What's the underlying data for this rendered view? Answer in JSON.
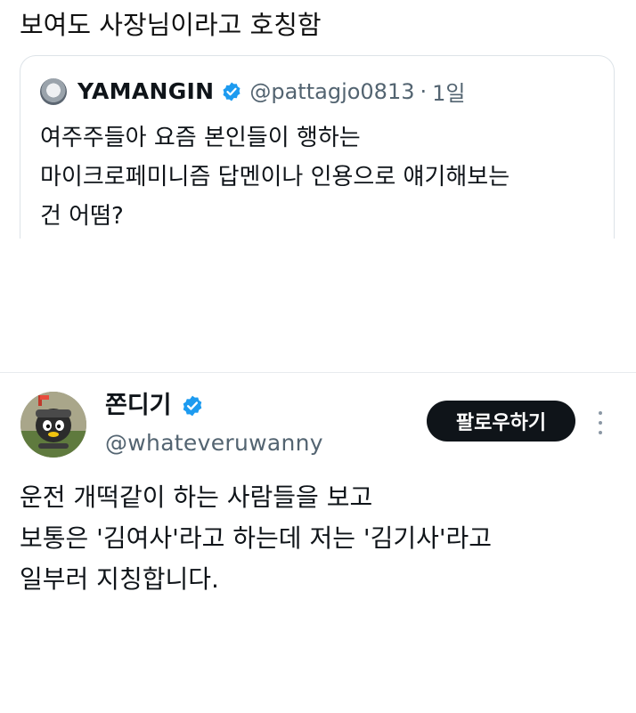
{
  "caption": "보여도 사장님이라고 호칭함",
  "quoted_tweet": {
    "display_name": "YAMANGIN",
    "handle": "@pattagjo0813",
    "separator": "·",
    "time": "1일",
    "text_lines": [
      "여주주들아 요즘 본인들이 행하는",
      "마이크로페미니즘 답멘이나 인용으로 얘기해보는",
      "건 어떰?"
    ]
  },
  "tweet": {
    "display_name": "쫀디기",
    "handle": "@whateveruwanny",
    "follow_label": "팔로우하기",
    "text_lines": [
      "운전 개떡같이 하는 사람들을 보고",
      "보통은 '김여사'라고 하는데 저는 '김기사'라고",
      "일부러 지칭합니다."
    ]
  },
  "icons": {
    "verified": "verified-badge-icon",
    "more": "more-options-icon"
  },
  "colors": {
    "verified_blue": "#1d9bf0",
    "follow_button_bg": "#0f1419",
    "secondary_text": "#536471"
  }
}
